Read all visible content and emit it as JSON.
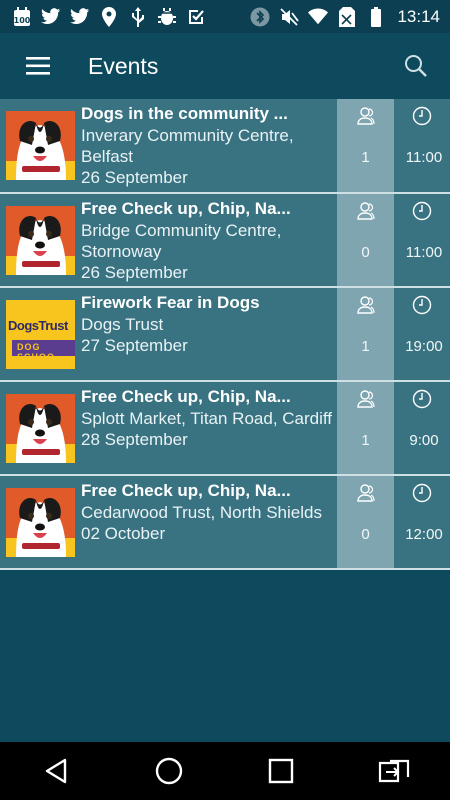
{
  "status": {
    "time": "13:14",
    "left_icons": [
      "calendar-100-icon",
      "twitter-icon",
      "twitter-icon",
      "location-pin-icon",
      "usb-icon",
      "android-debug-icon",
      "checkbox-icon"
    ],
    "right_icons": [
      "bluetooth-icon",
      "mute-icon",
      "wifi-icon",
      "no-sim-icon",
      "battery-icon"
    ]
  },
  "appbar": {
    "title": "Events"
  },
  "events": [
    {
      "title": "Dogs in the community ...",
      "venue": "Inverary Community Centre, Belfast",
      "date": "26 September",
      "attendees": "1",
      "time": "11:00",
      "image": "dog"
    },
    {
      "title": "Free Check up, Chip, Na...",
      "venue": "Bridge Community Centre, Stornoway",
      "date": "26 September",
      "attendees": "0",
      "time": "11:00",
      "image": "dog"
    },
    {
      "title": "Firework Fear in Dogs",
      "venue": "Dogs Trust",
      "date": "27 September",
      "attendees": "1",
      "time": "19:00",
      "image": "dogstrust",
      "logo_text": "DogsTrust",
      "logo_sub": "DOG SCHOO"
    },
    {
      "title": "Free Check up, Chip, Na...",
      "venue": "Splott Market, Titan Road, Cardiff",
      "date": "28 September",
      "attendees": "1",
      "time": "9:00",
      "image": "dog"
    },
    {
      "title": "Free Check up, Chip, Na...",
      "venue": "Cedarwood Trust, North Shields",
      "date": "02 October",
      "attendees": "0",
      "time": "12:00",
      "image": "dog"
    }
  ],
  "colors": {
    "background": "#0d4a5e",
    "row": "#397382",
    "attendee_column": "#7fa5b0",
    "divider": "#cfe0e5"
  }
}
